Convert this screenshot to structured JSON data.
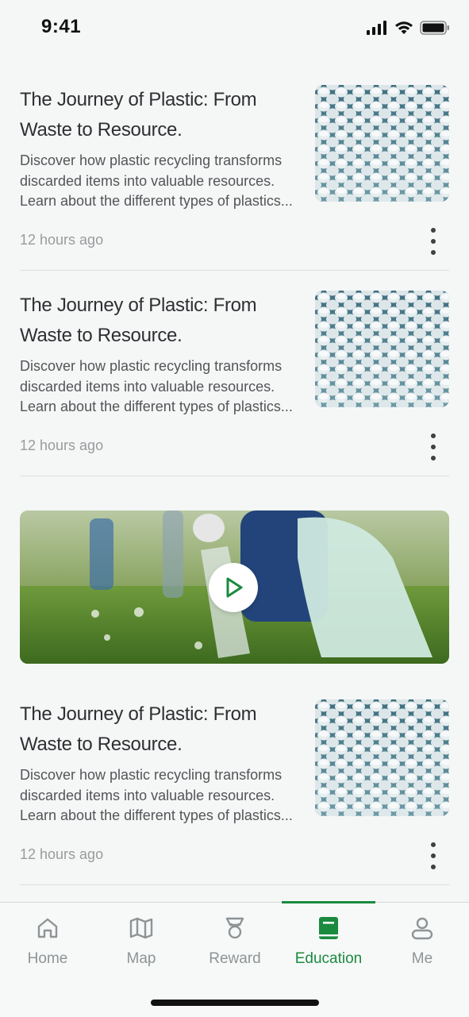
{
  "status_bar": {
    "time": "9:41"
  },
  "articles": [
    {
      "title": "The Journey of Plastic: From Waste to Resource.",
      "description": "Discover how plastic recycling transforms discarded items into valuable resources. Learn about the different types of plastics...",
      "time": "12 hours ago"
    },
    {
      "title": "The Journey of Plastic: From Waste to Resource.",
      "description": "Discover how plastic recycling transforms discarded items into valuable resources. Learn about the different types of plastics...",
      "time": "12 hours ago"
    },
    {
      "title": "The Journey of Plastic: From Waste to Resource.",
      "description": "Discover how plastic recycling transforms discarded items into valuable resources. Learn about the different types of plastics...",
      "time": "12 hours ago"
    }
  ],
  "tabs": [
    {
      "label": "Home",
      "icon": "home-icon"
    },
    {
      "label": "Map",
      "icon": "map-icon"
    },
    {
      "label": "Reward",
      "icon": "trophy-icon"
    },
    {
      "label": "Education",
      "icon": "book-icon",
      "active": true
    },
    {
      "label": "Me",
      "icon": "user-icon"
    }
  ],
  "colors": {
    "accent": "#1a8a3f",
    "inactive": "#8e9496",
    "background": "#f5f7f6"
  }
}
